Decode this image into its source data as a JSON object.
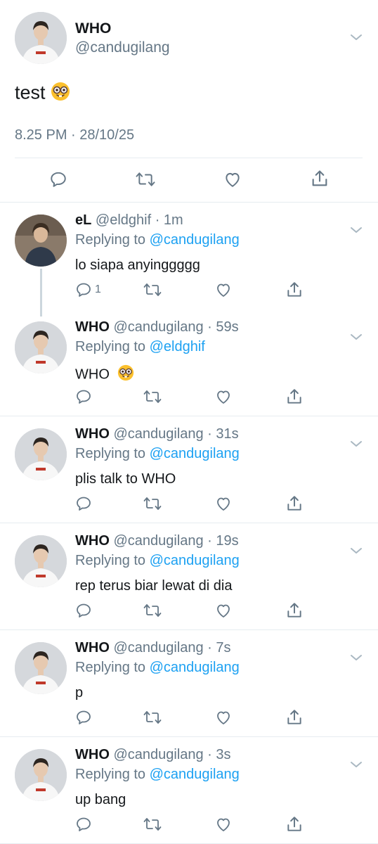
{
  "main_tweet": {
    "display_name": "WHO",
    "handle": "@candugilang",
    "text": "test",
    "emoji": "nerd-face",
    "timestamp": "8.25 PM · 28/10/25"
  },
  "replies": [
    {
      "display_name": "eL",
      "handle": "@eldghif · 1m",
      "replying_prefix": "Replying to ",
      "replying_to": "@candugilang",
      "text": "lo siapa anyinggggg",
      "reply_count": "1"
    },
    {
      "display_name": "WHO",
      "handle": "@candugilang · 59s",
      "replying_prefix": "Replying to ",
      "replying_to": "@eldghif",
      "text": "WHO",
      "emoji": "nerd-face"
    },
    {
      "display_name": "WHO",
      "handle": "@candugilang · 31s",
      "replying_prefix": "Replying to ",
      "replying_to": "@candugilang",
      "text": "plis talk to WHO"
    },
    {
      "display_name": "WHO",
      "handle": "@candugilang · 19s",
      "replying_prefix": "Replying to ",
      "replying_to": "@candugilang",
      "text": "rep terus biar lewat di dia"
    },
    {
      "display_name": "WHO",
      "handle": "@candugilang · 7s",
      "replying_prefix": "Replying to ",
      "replying_to": "@candugilang",
      "text": "p"
    },
    {
      "display_name": "WHO",
      "handle": "@candugilang · 3s",
      "replying_prefix": "Replying to ",
      "replying_to": "@candugilang",
      "text": "up bang"
    }
  ],
  "colors": {
    "link": "#1da1f2",
    "secondary_text": "#657786",
    "divider": "#e6ecf0",
    "thread_line": "#ccd6dd"
  },
  "icons": {
    "actions": [
      "reply-icon",
      "retweet-icon",
      "like-icon",
      "share-icon"
    ],
    "menu": "chevron-down-icon"
  }
}
